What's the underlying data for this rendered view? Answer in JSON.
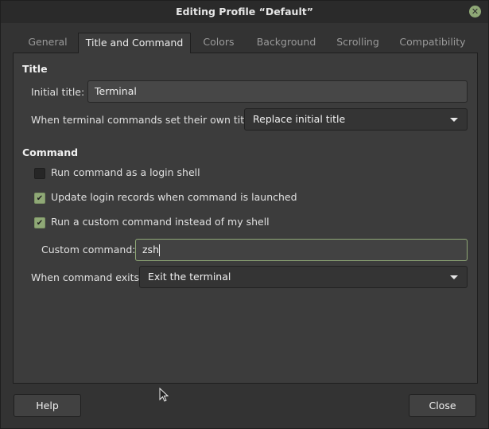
{
  "window": {
    "title": "Editing Profile “Default”"
  },
  "tabs": [
    {
      "label": "General"
    },
    {
      "label": "Title and Command",
      "active": true
    },
    {
      "label": "Colors"
    },
    {
      "label": "Background"
    },
    {
      "label": "Scrolling"
    },
    {
      "label": "Compatibility"
    }
  ],
  "title_section": {
    "heading": "Title",
    "initial_title_label": "Initial title:",
    "initial_title_value": "Terminal",
    "own_titles_label": "When terminal commands set their own titles:",
    "own_titles_value": "Replace initial title"
  },
  "command_section": {
    "heading": "Command",
    "checkboxes": [
      {
        "label": "Run command as a login shell",
        "checked": false
      },
      {
        "label": "Update login records when command is launched",
        "checked": true
      },
      {
        "label": "Run a custom command instead of my shell",
        "checked": true
      }
    ],
    "custom_command_label": "Custom command:",
    "custom_command_value": "zsh",
    "exit_label": "When command exits:",
    "exit_value": "Exit the terminal"
  },
  "buttons": {
    "help": "Help",
    "close": "Close"
  },
  "colors": {
    "accent": "#8fa876",
    "background": "#383838"
  }
}
